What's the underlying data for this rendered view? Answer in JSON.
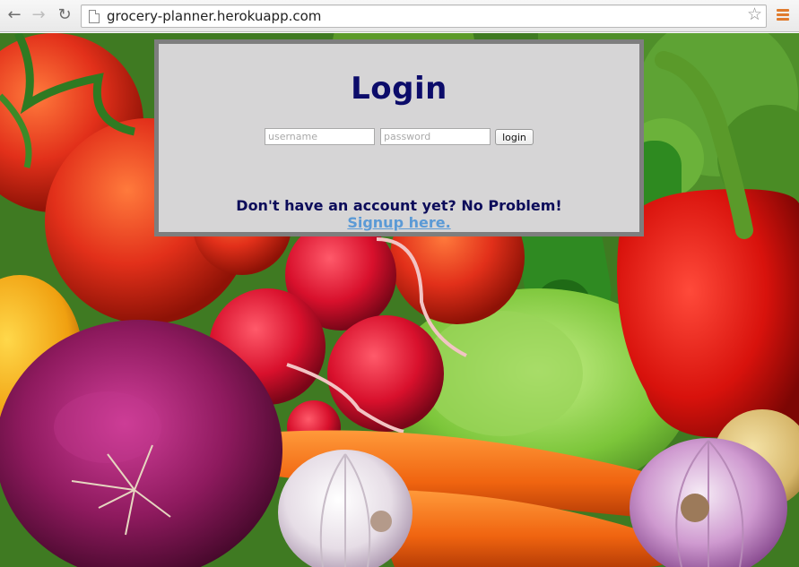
{
  "browser": {
    "url": "grocery-planner.herokuapp.com",
    "icons": {
      "back": "back-arrow-icon",
      "forward": "forward-arrow-icon",
      "reload": "reload-icon",
      "page": "page-icon",
      "bookmark": "star-icon",
      "menu": "hamburger-menu-icon"
    }
  },
  "login": {
    "title": "Login",
    "username_placeholder": "username",
    "password_placeholder": "password",
    "button_label": "login",
    "no_account_text": "Don't have an account yet? No Problem!",
    "signup_link": "Signup here."
  },
  "colors": {
    "title": "#0c0c6a",
    "panel_bg": "#d6d5d6",
    "panel_border": "#7e7e7e",
    "link": "#5b9ad6",
    "menu_accent": "#e07b2e"
  }
}
